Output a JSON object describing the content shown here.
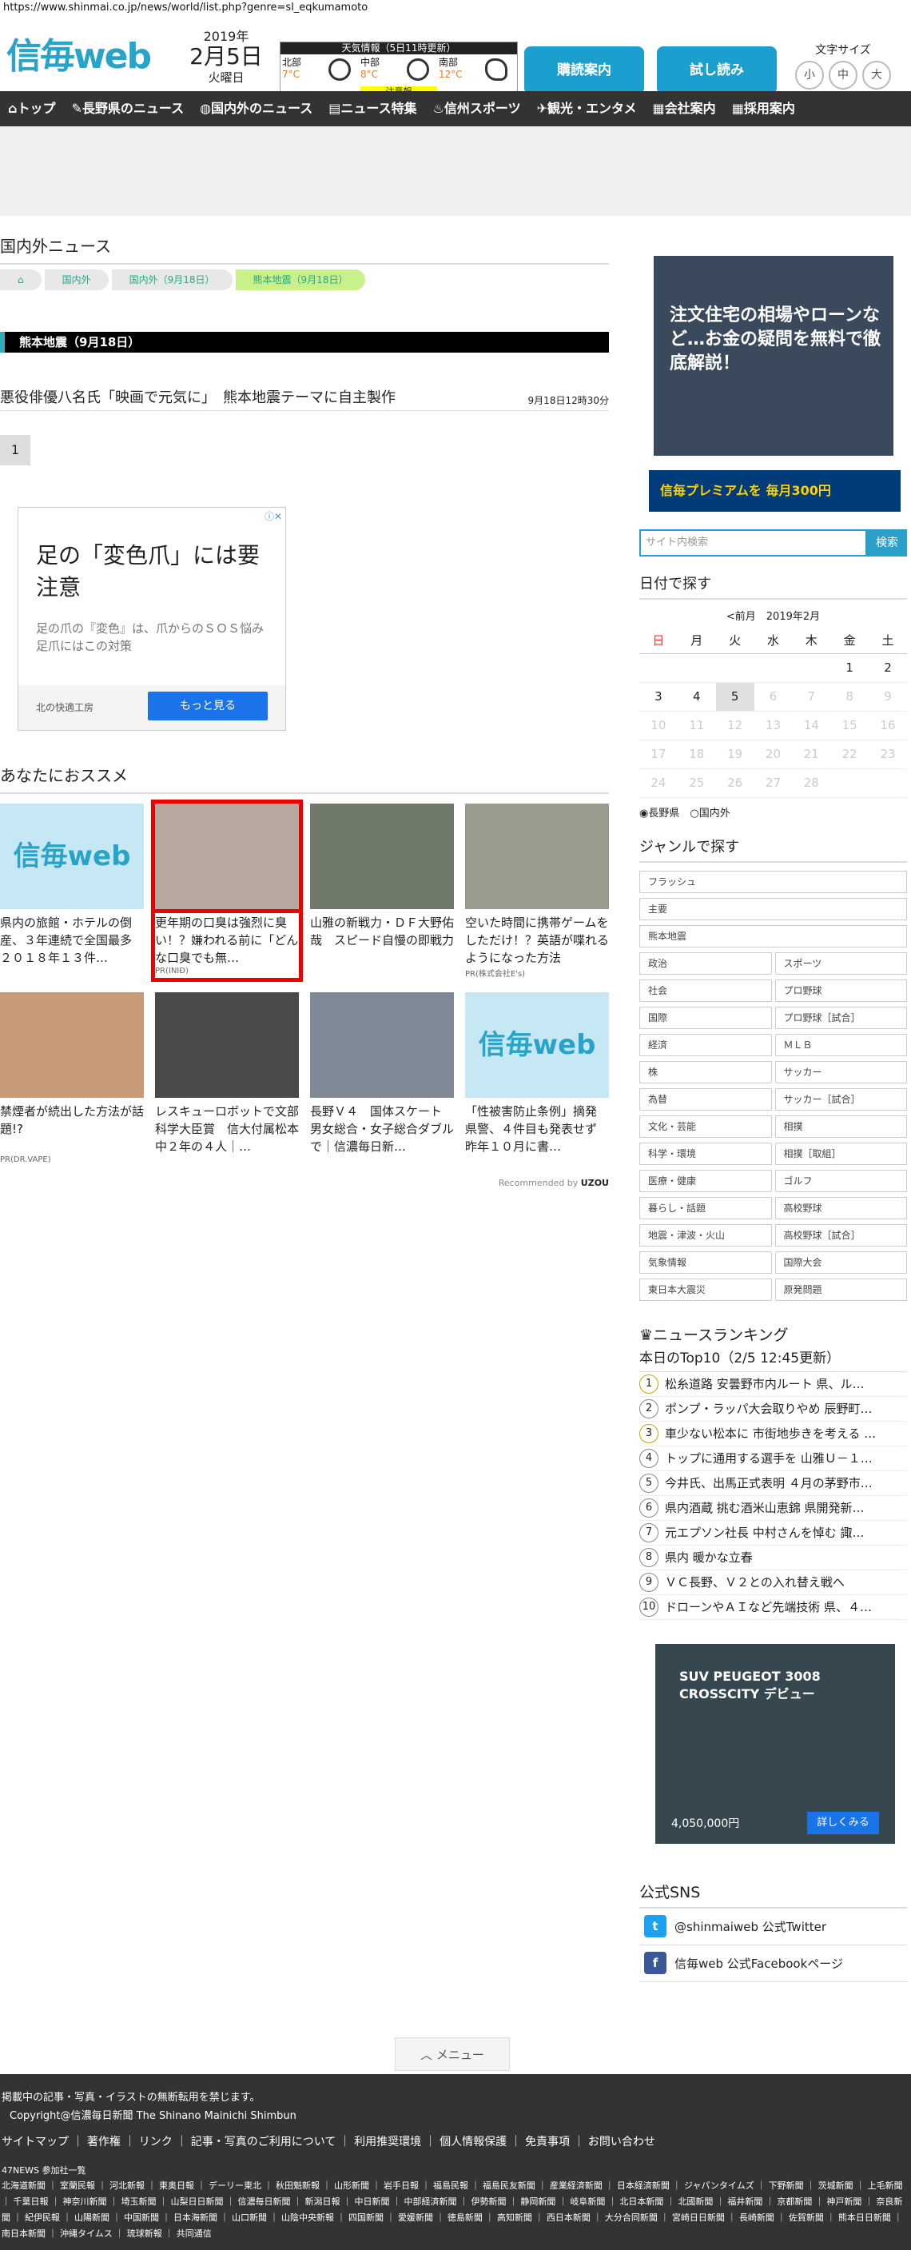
{
  "url": "https://www.shinmai.co.jp/news/world/list.php?genre=sl_eqkumamoto",
  "logo": {
    "kanji": "信毎",
    "web": "web"
  },
  "date": {
    "year": "2019年",
    "day": "2月5日",
    "weekday": "火曜日"
  },
  "weather": {
    "title": "天気情報（5日11時更新）",
    "areas": [
      {
        "name": "北部",
        "temp": "7°C"
      },
      {
        "name": "中部",
        "temp": "8°C"
      },
      {
        "name": "南部",
        "temp": "12°C"
      }
    ],
    "warning": "注意報"
  },
  "buttons": {
    "delivery": "購読案内",
    "trial": "試し読み"
  },
  "fontsize": {
    "label": "文字サイズ",
    "small": "小",
    "medium": "中",
    "large": "大"
  },
  "nav": [
    "トップ",
    "長野県のニュース",
    "国内外のニュース",
    "ニュース特集",
    "信州スポーツ",
    "観光・エンタメ",
    "会社案内",
    "採用案内"
  ],
  "page_title": "国内外ニュース",
  "breadcrumb": [
    "国内外",
    "国内外（9月18日）",
    "熊本地震（9月18日）"
  ],
  "category": "熊本地震（9月18日）",
  "article": {
    "headline": "悪役俳優八名氏「映画で元気に」　熊本地震テーマに自主製作",
    "time": "9月18日12時30分"
  },
  "pagination": "1",
  "ad": {
    "title": "足の「変色爪」には要注意",
    "sub": "足の爪の『変色』は、爪からのＳＯＳ悩み足爪にはこの対策",
    "advertiser": "北の快適工房",
    "cta": "もっと見る"
  },
  "reco": {
    "title": "あなたにおススメ",
    "items": [
      {
        "text": "県内の旅館・ホテルの倒産、３年連続で全国最多　２０１８年１３件…",
        "pr": ""
      },
      {
        "text": "更年期の口臭は強烈に臭い！？嫌われる前に「どんな口臭でも無…",
        "pr": "PR(INIÐ)"
      },
      {
        "text": "山雅の新戦力・ＤＦ大野佑哉　スピード自慢の即戦力",
        "pr": ""
      },
      {
        "text": "空いた時間に携帯ゲームをしただけ！？英語が喋れるようになった方法",
        "pr": "PR(株式会社E's)"
      },
      {
        "text": "禁煙者が続出した方法が話題!?",
        "pr": "PR(DR.VAPE)"
      },
      {
        "text": "レスキューロボットで文部科学大臣賞　信大付属松本中２年の４人｜…",
        "pr": ""
      },
      {
        "text": "長野Ｖ４　国体スケート　男女総合・女子総合ダブルで｜信濃毎日新…",
        "pr": ""
      },
      {
        "text": "「性被害防止条例」摘発　県警、４件目も発表せず　昨年１０月に書…",
        "pr": ""
      }
    ],
    "by": "Recommended by"
  },
  "side_ad1": "注文住宅の相場やローンなど…お金の疑問を無料で徹底解説！",
  "side_ad2": "信毎プレミアムを 毎月300円",
  "search": {
    "placeholder": "サイト内検索",
    "button": "検索"
  },
  "calendar": {
    "title": "日付で探す",
    "prev": "<前月",
    "month": "2019年2月",
    "weekdays": [
      "日",
      "月",
      "火",
      "水",
      "木",
      "金",
      "土"
    ],
    "area": [
      "長野県",
      "国内外"
    ]
  },
  "genre": {
    "title": "ジャンルで探す",
    "full": [
      "フラッシュ",
      "主要",
      "熊本地震"
    ],
    "pairs": [
      [
        "政治",
        "スポーツ"
      ],
      [
        "社会",
        "プロ野球"
      ],
      [
        "国際",
        "プロ野球［試合］"
      ],
      [
        "経済",
        "ＭＬＢ"
      ],
      [
        "株",
        "サッカー"
      ],
      [
        "為替",
        "サッカー［試合］"
      ],
      [
        "文化・芸能",
        "相撲"
      ],
      [
        "科学・環境",
        "相撲［取組］"
      ],
      [
        "医療・健康",
        "ゴルフ"
      ],
      [
        "暮らし・話題",
        "高校野球"
      ],
      [
        "地震・津波・火山",
        "高校野球［試合］"
      ],
      [
        "気象情報",
        "国際大会"
      ],
      [
        "東日本大震災",
        "原発問題"
      ]
    ]
  },
  "ranking": {
    "title": "ニュースランキング",
    "sub": "本日のTop10（2/5 12:45更新）",
    "items": [
      "松糸道路 安曇野市内ルート 県、ル…",
      "ポンプ・ラッパ大会取りやめ 辰野町…",
      "車少ない松本に 市街地歩きを考える …",
      "トップに通用する選手を 山雅Ｕ－１…",
      "今井氏、出馬正式表明 ４月の茅野市…",
      "県内酒蔵 挑む酒米山恵錦 県開発新…",
      "元エプソン社長 中村さんを悼む 諏…",
      "県内 暖かな立春",
      "ＶＣ長野、Ｖ２との入れ替え戦へ",
      "ドローンやＡＩなど先端技術 県、４…"
    ]
  },
  "side_ad3": {
    "title": "SUV PEUGEOT 3008 CROSSCITY デビュー",
    "price": "4,050,000円",
    "cta": "詳しくみる"
  },
  "sns": {
    "title": "公式SNS",
    "twitter": "@shinmaiweb 公式Twitter",
    "facebook": "信毎web 公式Facebookページ"
  },
  "menu": "メニュー",
  "footer": {
    "notice": "掲載中の記事・写真・イラストの無断転用を禁じます。",
    "copyright": "Copyright@信濃毎日新聞 The Shinano Mainichi Shimbun",
    "links": "サイトマップ ｜ 著作権 ｜ リンク ｜ 記事・写真のご利用について ｜ 利用推奨環境 ｜ 個人情報保護 ｜ 免責事項 ｜ お問い合わせ",
    "np_title": "47NEWS 参加社一覧",
    "papers": "北海道新聞 ｜ 室蘭民報 ｜ 河北新報 ｜ 東奥日報 ｜ デーリー東北 ｜ 秋田魁新報 ｜ 山形新聞 ｜ 岩手日報 ｜ 福島民報 ｜ 福島民友新聞 ｜ 産業経済新聞 ｜ 日本経済新聞 ｜ ジャパンタイムズ ｜ 下野新聞 ｜ 茨城新聞 ｜ 上毛新聞 ｜ 千葉日報 ｜ 神奈川新聞 ｜ 埼玉新聞 ｜ 山梨日日新聞 ｜ 信濃毎日新聞 ｜ 新潟日報 ｜ 中日新聞 ｜ 中部経済新聞 ｜ 伊勢新聞 ｜ 静岡新聞 ｜ 岐阜新聞 ｜ 北日本新聞 ｜ 北國新聞 ｜ 福井新聞 ｜ 京都新聞 ｜ 神戸新聞 ｜ 奈良新聞 ｜ 紀伊民報 ｜ 山陽新聞 ｜ 中国新聞 ｜ 日本海新聞 ｜ 山口新聞 ｜ 山陰中央新報 ｜ 四国新聞 ｜ 愛媛新聞 ｜ 徳島新聞 ｜ 高知新聞 ｜ 西日本新聞 ｜ 大分合同新聞 ｜ 宮崎日日新聞 ｜ 長崎新聞 ｜ 佐賀新聞 ｜ 熊本日日新聞 ｜ 南日本新聞 ｜ 沖縄タイムス ｜ 琉球新報 ｜ 共同通信"
  }
}
